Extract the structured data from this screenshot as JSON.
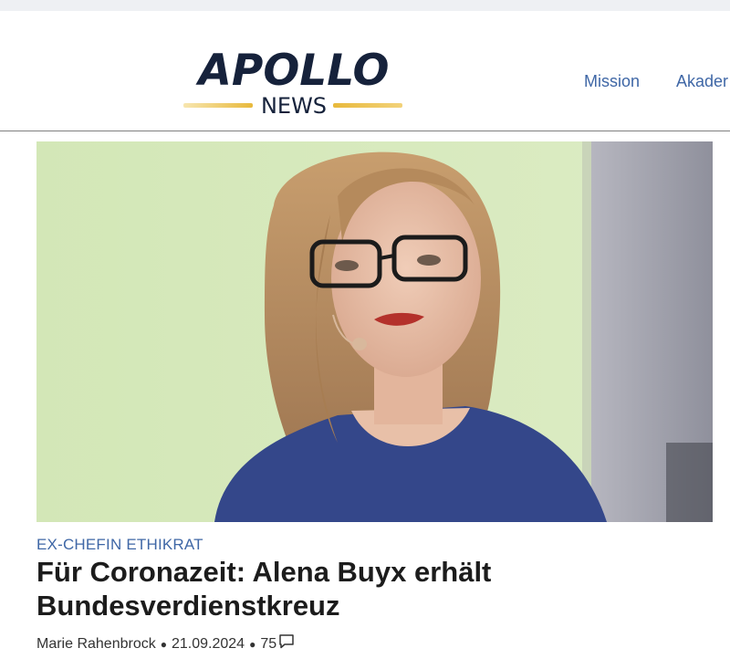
{
  "header": {
    "logo_main": "APOLLO",
    "logo_sub": "NEWS",
    "nav": [
      "Mission",
      "Akader"
    ]
  },
  "article": {
    "category": "EX-CHEFIN ETHIKRAT",
    "headline": "Für Coronazeit: Alena Buyx erhält Bundesverdienstkreuz",
    "author": "Marie Rahenbrock",
    "date": "21.09.2024",
    "comments": "75"
  },
  "colors": {
    "brand_navy": "#16223b",
    "accent_blue": "#3f67a6",
    "logo_gold": "#e8b93c"
  },
  "icons": [
    "comment-icon"
  ]
}
